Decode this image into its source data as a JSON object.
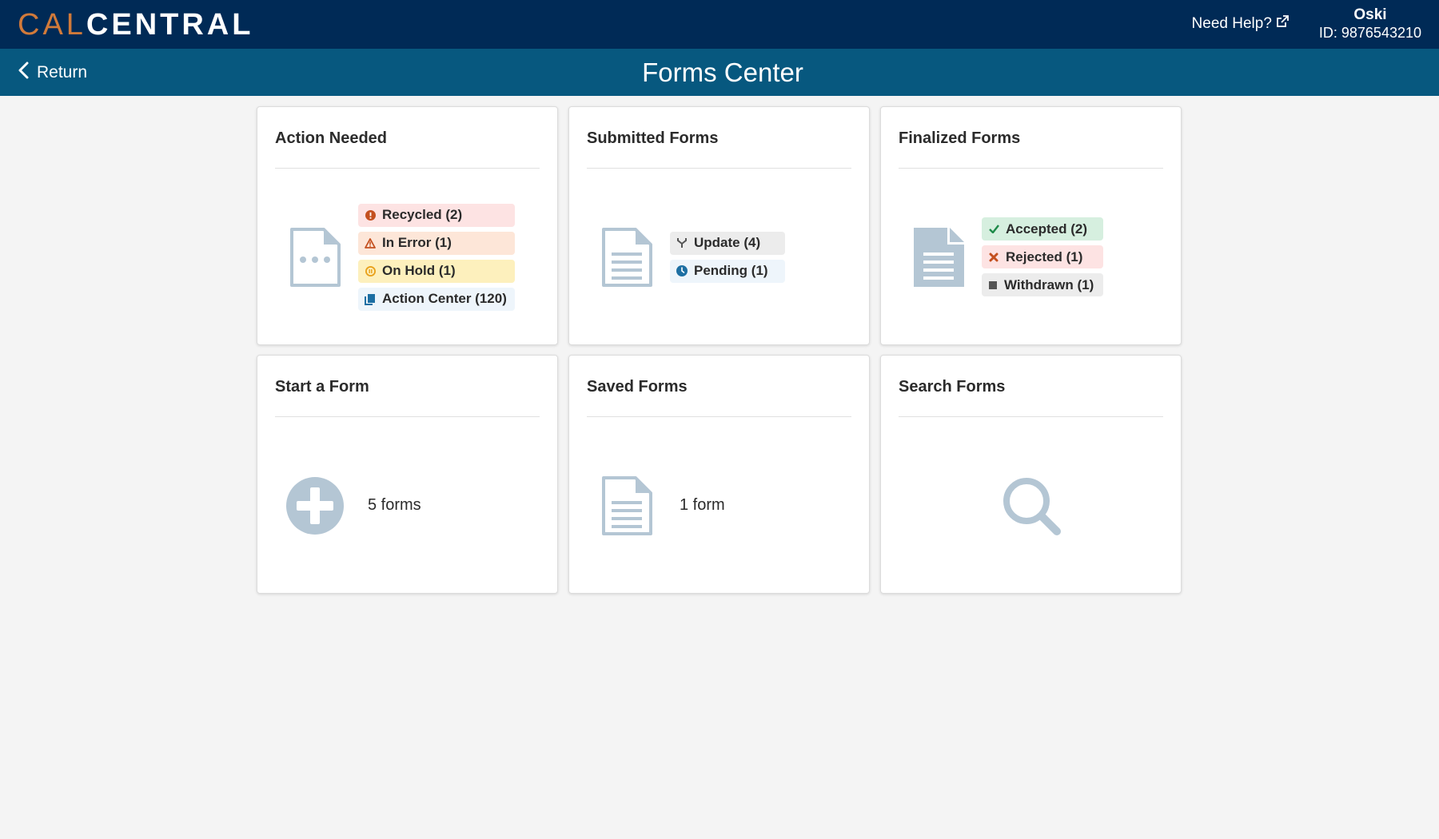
{
  "header": {
    "logo_cal": "CAL",
    "logo_central": "CENTRAL",
    "need_help": "Need Help?",
    "user_name": "Oski",
    "user_id": "ID: 9876543210"
  },
  "subheader": {
    "return_label": "Return",
    "title": "Forms Center"
  },
  "cards": {
    "action_needed": {
      "title": "Action Needed",
      "badges": [
        {
          "label": "Recycled (2)",
          "icon": "exclamation-circle-icon",
          "bg": "#fde3e3",
          "icon_color": "#c4501f"
        },
        {
          "label": "In Error (1)",
          "icon": "warning-triangle-icon",
          "bg": "#fde6d8",
          "icon_color": "#c4501f"
        },
        {
          "label": "On Hold (1)",
          "icon": "pause-circle-icon",
          "bg": "#fdf0bd",
          "icon_color": "#e9a21c"
        },
        {
          "label": "Action Center (120)",
          "icon": "copy-icon",
          "bg": "#eef5fb",
          "icon_color": "#1d6fa3"
        }
      ]
    },
    "submitted": {
      "title": "Submitted Forms",
      "badges": [
        {
          "label": "Update (4)",
          "icon": "branch-icon",
          "bg": "#ececec",
          "icon_color": "#555555"
        },
        {
          "label": "Pending (1)",
          "icon": "clock-icon",
          "bg": "#eef5fb",
          "icon_color": "#1d6fa3"
        }
      ]
    },
    "finalized": {
      "title": "Finalized Forms",
      "badges": [
        {
          "label": "Accepted (2)",
          "icon": "check-icon",
          "bg": "#d6efdf",
          "icon_color": "#1e8a49"
        },
        {
          "label": "Rejected (1)",
          "icon": "x-icon",
          "bg": "#fde3e3",
          "icon_color": "#c4501f"
        },
        {
          "label": "Withdrawn (1)",
          "icon": "square-icon",
          "bg": "#ececec",
          "icon_color": "#555555"
        }
      ]
    },
    "start": {
      "title": "Start a Form",
      "count": "5 forms"
    },
    "saved": {
      "title": "Saved Forms",
      "count": "1 form"
    },
    "search": {
      "title": "Search Forms"
    }
  },
  "colors": {
    "top_bar": "#002a56",
    "sub_bar": "#07587f",
    "logo_accent": "#d17a3a",
    "icon_gray_blue": "#b4c6d4"
  }
}
